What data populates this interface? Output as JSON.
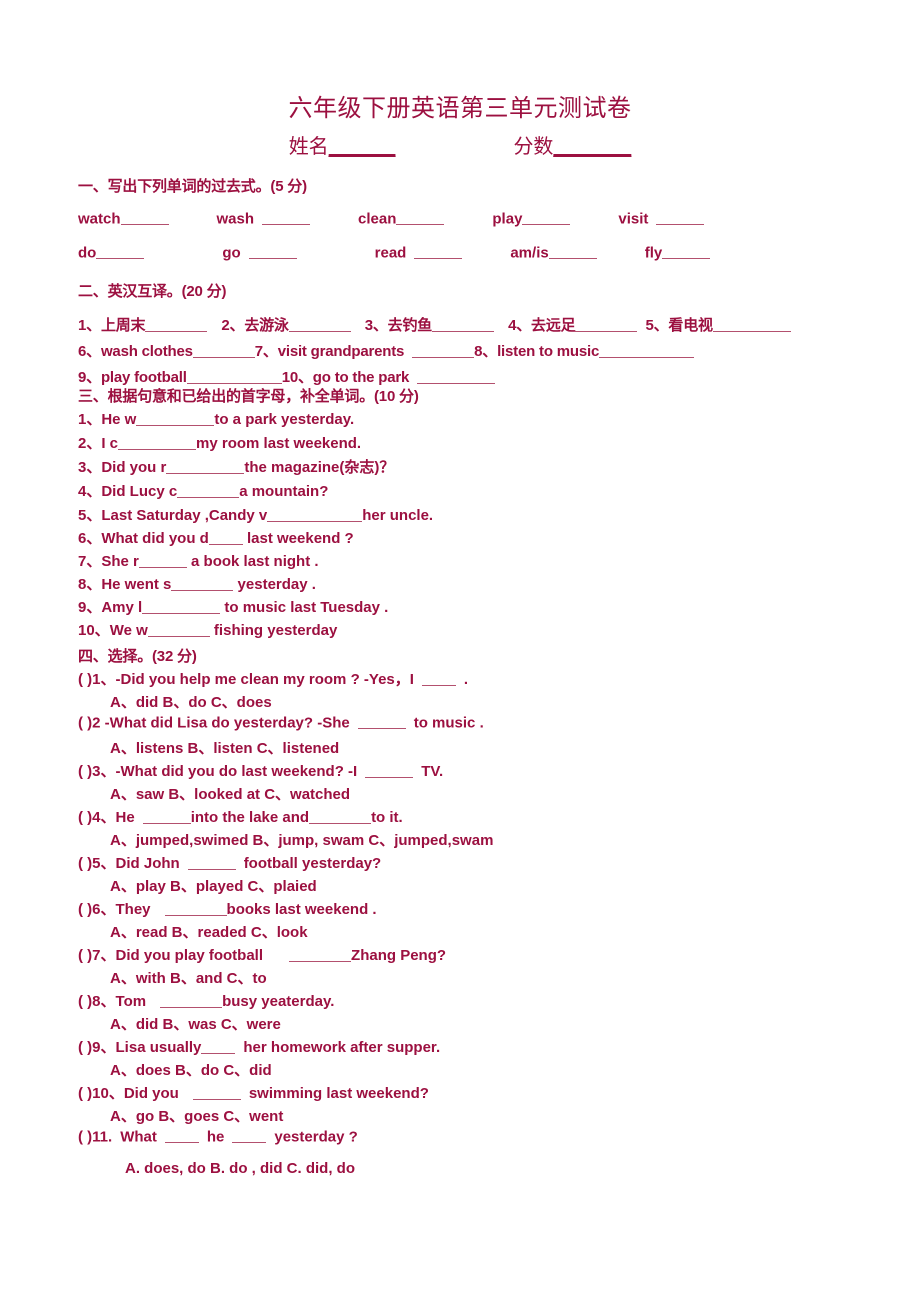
{
  "document": {
    "title": "六年级下册英语第三单元测试卷",
    "name_label": "姓名",
    "name_blank": "______",
    "score_label": "分数",
    "score_blank": "_______"
  },
  "section1": {
    "heading": "一、写出下列单词的过去式。(5 分)",
    "row1": [
      {
        "word": "watch"
      },
      {
        "word": "wash"
      },
      {
        "word": "clean"
      },
      {
        "word": "play"
      },
      {
        "word": "visit"
      }
    ],
    "row2": [
      {
        "word": "do"
      },
      {
        "word": "go"
      },
      {
        "word": "read"
      },
      {
        "word": "am/is"
      },
      {
        "word": "fly"
      }
    ]
  },
  "section2": {
    "heading": "二、英汉互译。(20 分)",
    "line1": [
      {
        "num": "1、",
        "text": "上周末"
      },
      {
        "num": "2、",
        "text": "去游泳"
      },
      {
        "num": "3、",
        "text": "去钓鱼"
      },
      {
        "num": "4、",
        "text": "去远足"
      },
      {
        "num": "5、",
        "text": "看电视"
      }
    ],
    "line2": [
      {
        "num": "6、",
        "text": "wash  clothes"
      },
      {
        "num": "7、",
        "text": "visit  grandparents"
      },
      {
        "num": "8、",
        "text": "listen  to  music"
      }
    ],
    "line3": [
      {
        "num": "9、",
        "text": "play  football"
      },
      {
        "num": "10、",
        "text": "go  to  the  park"
      }
    ]
  },
  "section3": {
    "heading": "三、根据句意和已给出的首字母，补全单词。(10 分)",
    "items": [
      {
        "num": "1、",
        "pre": "He   w",
        "post": "to  a  park  yesterday."
      },
      {
        "num": "2、",
        "pre": "I  c",
        "post": "my  room  last  weekend."
      },
      {
        "num": "3、",
        "pre": "Did  you  r",
        "post": "the  magazine(杂志)？"
      },
      {
        "num": "4、",
        "pre": "Did  Lucy  c",
        "post": "a   mountain?"
      },
      {
        "num": "5、",
        "pre": "Last  Saturday ,Candy  v",
        "post": "her uncle."
      },
      {
        "num": "6、",
        "pre": "What did  you  d",
        "post": " last weekend ?"
      },
      {
        "num": "7、",
        "pre": "She r",
        "post": " a book last night ."
      },
      {
        "num": "8、",
        "pre": "He  went  s",
        "post": " yesterday ."
      },
      {
        "num": "9、",
        "pre": "Amy  l",
        "post": " to music last Tuesday ."
      },
      {
        "num": "10、",
        "pre": "We  w",
        "post": " fishing yesterday"
      }
    ]
  },
  "section4": {
    "heading": "四、选择。(32 分)",
    "questions": [
      {
        "marker": "(  )1、",
        "stem_a": "-Did  you  help  me  clean  my  room ? -Yes，I",
        "stem_b": ".",
        "options": "A、did          B、do        C、does"
      },
      {
        "marker": "(  )2 ",
        "stem_a": "-What  did  Lisa   do  yesterday? -She",
        "stem_b": "to   music .",
        "options": "A、listens        B、listen       C、listened"
      },
      {
        "marker": "(  )3、",
        "stem_a": "-What  did you  do  last  weekend?            -I",
        "stem_b": "TV.",
        "options": "A、saw            B、looked  at       C、watched"
      },
      {
        "marker": "(  )4、",
        "stem_a": "He",
        "stem_b": "into  the  lake  and",
        "stem_c": "to  it.",
        "options": "A、jumped,swimed     B、jump, swam       C、jumped,swam"
      },
      {
        "marker": "(  )5、",
        "stem_a": "Did  John",
        "stem_b": "football  yesterday?",
        "options": "A、play      B、played        C、plaied"
      },
      {
        "marker": "(  )6、",
        "stem_a": "They",
        "stem_b": "books  last  weekend .",
        "options": "A、read      B、readed       C、look"
      },
      {
        "marker": "(  )7、",
        "stem_a": "Did  you  play  football",
        "stem_b": "Zhang Peng?",
        "options": "A、with            B、and       C、to"
      },
      {
        "marker": "(  )8、",
        "stem_a": "Tom",
        "stem_b": "busy yeaterday.",
        "options": "A、did        B、was     C、were"
      },
      {
        "marker": "(  )9、",
        "stem_a": "Lisa  usually",
        "stem_b": "her  homework  after  supper.",
        "options": "A、does       B、do        C、did"
      },
      {
        "marker": "(  )10、",
        "stem_a": "Did  you",
        "stem_b": "swimming  last  weekend?",
        "options": "A、go        B、goes        C、went"
      },
      {
        "marker": "(  )11.",
        "stem_a": "What",
        "stem_b": "he",
        "stem_c": "yesterday ?",
        "options": "A. does, do     B. do , did    C. did, do"
      }
    ]
  }
}
